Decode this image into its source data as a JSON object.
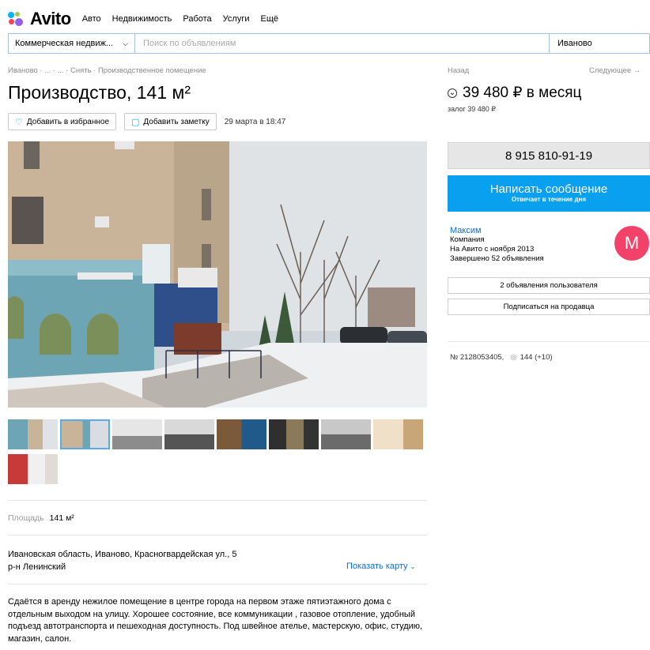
{
  "header": {
    "logo_text": "Avito",
    "nav": [
      "Авто",
      "Недвижимость",
      "Работа",
      "Услуги",
      "Ещё"
    ]
  },
  "search": {
    "category": "Коммерческая недвиж...",
    "placeholder": "Поиск по объявлениям",
    "city": "Иваново"
  },
  "breadcrumb": "Иваново · ... · ... · Снять · Производственное помещение",
  "nav_links": {
    "back": "Назад",
    "next": "Следующее →"
  },
  "listing": {
    "title": "Производство, 141 м²",
    "price": "39 480 ₽ в месяц",
    "deposit": "залог 39 480 ₽",
    "favorite_label": "Добавить в избранное",
    "note_label": "Добавить заметку",
    "date": "29 марта в 18:47",
    "area_label": "Площадь",
    "area_value": "141 м²",
    "address_line1": "Ивановская область, Иваново, Красногвардейская ул., 5",
    "address_line2": "р-н Ленинский",
    "show_map": "Показать карту",
    "description": "Сдаётся в аренду нежилое помещение в центре города на первом этаже пятиэтажного дома с отдельным выходом на улицу. Хорошее состояние, все коммуникации , газовое отопление, удобный подъезд автотранспорта и пешеходная доступность. Под швейное ателье, мастерскую, офис, студию, магазин, салон.",
    "thumbnail_count": 9,
    "active_thumbnail": 1
  },
  "sidebar": {
    "phone": "8 915 810-91-19",
    "message_title": "Написать сообщение",
    "message_sub": "Отвечает в течение дня",
    "seller_name": "Максим",
    "seller_type": "Компания",
    "seller_since": "На Авито с ноября 2013",
    "seller_done": "Завершено 52 объявления",
    "avatar_letter": "М",
    "user_ads": "2 объявления пользователя",
    "subscribe": "Подписаться на продавца",
    "ad_number": "№ 2128053405,",
    "views": "144 (+10)"
  },
  "colors": {
    "accent": "#0aa0f0",
    "link": "#0a6ed1",
    "avatar": "#f3426a",
    "logo_dots": [
      "#00b2ff",
      "#96d14a",
      "#ff4053",
      "#965eeb"
    ]
  }
}
